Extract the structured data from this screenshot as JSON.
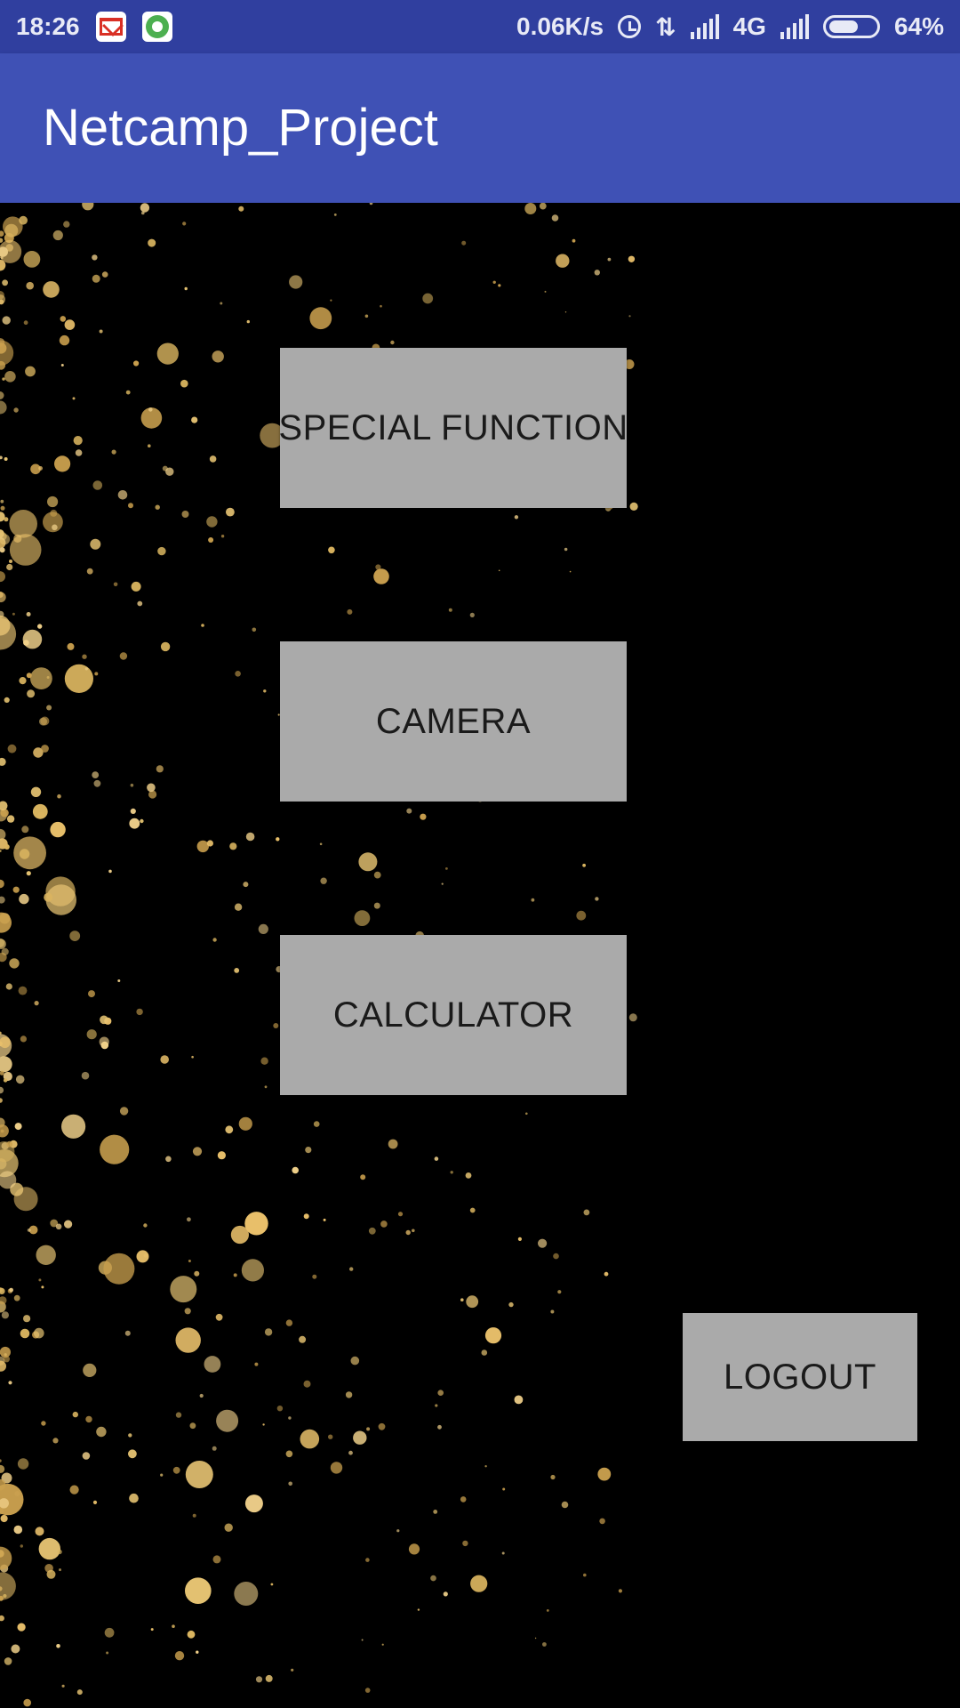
{
  "status_bar": {
    "time": "18:26",
    "notifications": [
      "gmail-icon",
      "hangouts-icon"
    ],
    "network_speed": "0.06K/s",
    "network_type": "4G",
    "battery": "64%",
    "battery_level": 0.64
  },
  "app_bar": {
    "title": "Netcamp_Project",
    "color": "#3f51b5"
  },
  "buttons": {
    "special_function": "SPECIAL FUNCTION",
    "camera": "CAMERA",
    "calculator": "CALCULATOR",
    "logout": "LOGOUT"
  },
  "colors": {
    "status_bar": "#303f9f",
    "button_bg": "#aaaaaa",
    "background": "#000000",
    "particles": "#e0b865"
  }
}
